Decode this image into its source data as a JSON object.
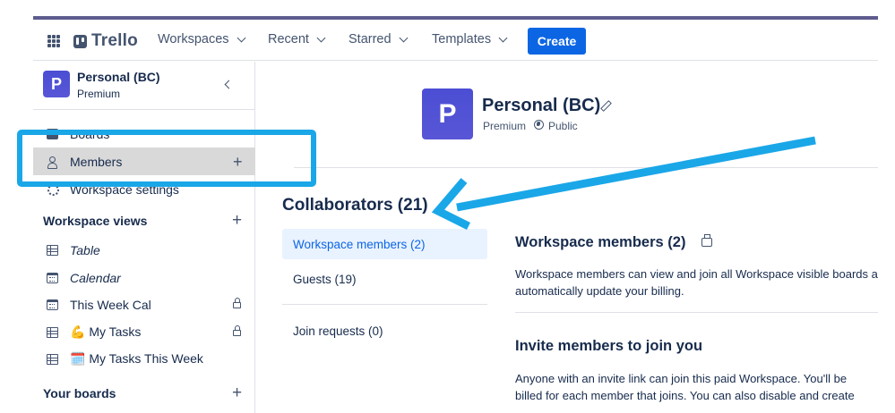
{
  "header": {
    "logo": "Trello",
    "nav": [
      "Workspaces",
      "Recent",
      "Starred",
      "Templates"
    ],
    "create_label": "Create"
  },
  "sidebar": {
    "workspace_initial": "P",
    "workspace_name": "Personal (BC)",
    "workspace_plan": "Premium",
    "items": [
      {
        "label": "Boards",
        "icon": "board-icon"
      },
      {
        "label": "Members",
        "icon": "person-icon"
      },
      {
        "label": "Workspace settings",
        "icon": "gear-icon"
      }
    ],
    "views_heading": "Workspace views",
    "views": [
      {
        "label": "Table",
        "icon": "table-icon",
        "italic": true
      },
      {
        "label": "Calendar",
        "icon": "calendar-icon",
        "italic": true
      },
      {
        "label": "This Week Cal",
        "icon": "calendar-icon",
        "locked": true
      },
      {
        "label": "💪 My Tasks",
        "icon": "table-icon",
        "locked": true
      },
      {
        "label": "🗓️ My Tasks This Week",
        "icon": "table-icon"
      }
    ],
    "boards_heading": "Your boards"
  },
  "main": {
    "initial": "P",
    "title": "Personal (BC)",
    "plan": "Premium",
    "visibility": "Public",
    "collaborators_title": "Collaborators (21)",
    "tabs": [
      "Workspace members (2)",
      "Guests (19)",
      "Join requests (0)"
    ],
    "members_title": "Workspace members (2)",
    "members_desc": [
      "Workspace members can view and join all Workspace visible boards and create new boards in the Workspace. Adding new members will",
      "automatically update your billing."
    ],
    "invite_title": "Invite members to join you",
    "invite_desc": [
      "Anyone with an invite link can join this paid Workspace. You'll be",
      "billed for each member that joins. You can also disable and create"
    ]
  },
  "annotation": {
    "color": "#1aa7e8"
  },
  "colors": {
    "accent": "#0c66e4",
    "avatar": "#5856d6",
    "topline": "#5e5c8f"
  }
}
